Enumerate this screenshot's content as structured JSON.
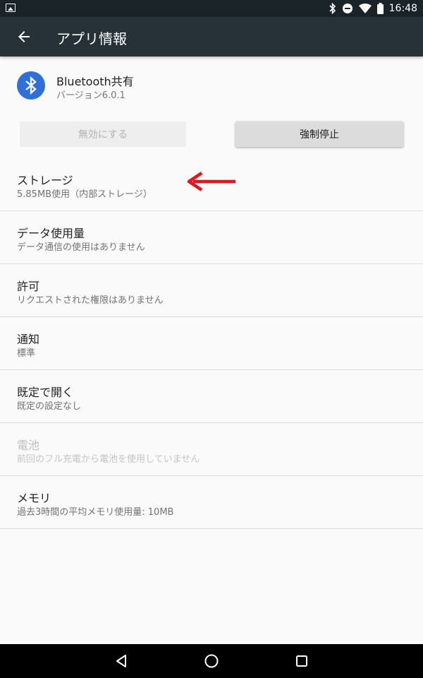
{
  "status_bar": {
    "time": "16:48",
    "icons": [
      "image-notification-icon",
      "bluetooth-icon",
      "do-not-disturb-icon",
      "wifi-icon",
      "battery-icon"
    ]
  },
  "app_bar": {
    "title": "アプリ情報",
    "back_icon": "arrow-back-icon"
  },
  "app_header": {
    "name": "Bluetooth共有",
    "version": "バージョン6.0.1",
    "icon": "bluetooth-icon",
    "icon_color": "#2f6fd8"
  },
  "buttons": {
    "disable_label": "無効にする",
    "force_stop_label": "強制停止"
  },
  "list": [
    {
      "title": "ストレージ",
      "subtitle": "5.85MB使用（内部ストレージ）",
      "enabled": true
    },
    {
      "title": "データ使用量",
      "subtitle": "データ通信の使用はありません",
      "enabled": true
    },
    {
      "title": "許可",
      "subtitle": "リクエストされた権限はありません",
      "enabled": true
    },
    {
      "title": "通知",
      "subtitle": "標準",
      "enabled": true
    },
    {
      "title": "既定で開く",
      "subtitle": "既定の設定なし",
      "enabled": true
    },
    {
      "title": "電池",
      "subtitle": "前回のフル充電から電池を使用していません",
      "enabled": false
    },
    {
      "title": "メモリ",
      "subtitle": "過去3時間の平均メモリ使用量: 10MB",
      "enabled": true
    }
  ],
  "annotation": {
    "arrow_color": "#e8141a"
  },
  "nav_bar": {
    "icons": [
      "back-triangle-icon",
      "home-circle-icon",
      "recents-square-icon"
    ]
  }
}
